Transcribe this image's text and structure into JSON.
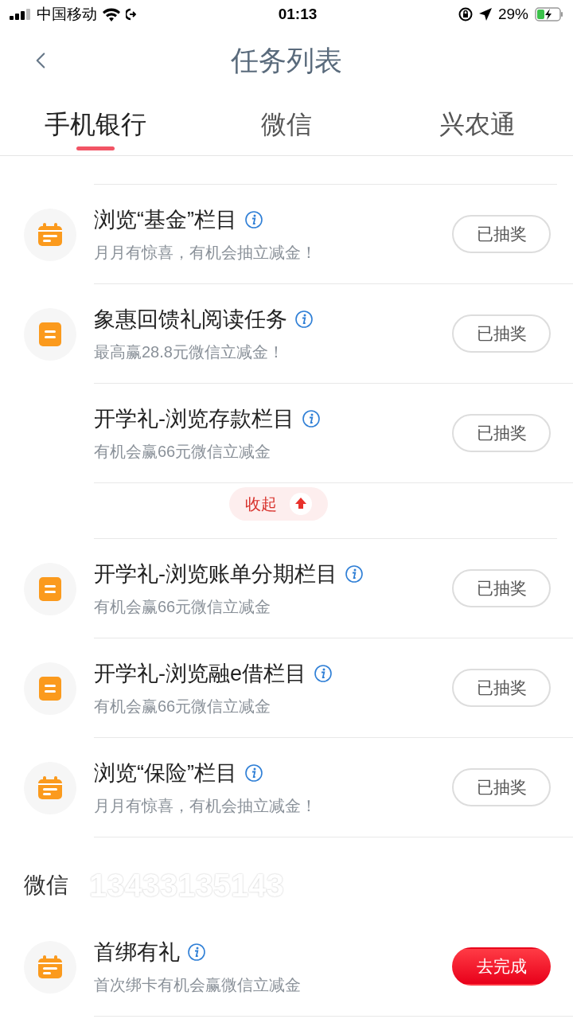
{
  "status_bar": {
    "carrier": "中国移动",
    "time": "01:13",
    "battery": "29%"
  },
  "header": {
    "title": "任务列表"
  },
  "tabs": [
    {
      "label": "手机银行",
      "selected": true
    },
    {
      "label": "微信",
      "selected": false
    },
    {
      "label": "兴农通",
      "selected": false
    }
  ],
  "sections": [
    {
      "tasks": [
        {
          "kind": "calendar",
          "title": "浏览“基金”栏目",
          "subtitle": "月月有惊喜，有机会抽立减金！",
          "button": {
            "label": "已抽奖",
            "kind": "done"
          }
        },
        {
          "kind": "document",
          "title": "象惠回馈礼阅读任务",
          "subtitle": "最高赢28.8元微信立减金！",
          "button": {
            "label": "已抽奖",
            "kind": "done"
          }
        },
        {
          "kind": "plain",
          "title": "开学礼-浏览存款栏目",
          "subtitle": "有机会赢66元微信立减金",
          "button": {
            "label": "已抽奖",
            "kind": "done"
          }
        },
        {
          "kind": "collapse",
          "label": "收起"
        },
        {
          "kind": "document",
          "title": "开学礼-浏览账单分期栏目",
          "subtitle": "有机会赢66元微信立减金",
          "button": {
            "label": "已抽奖",
            "kind": "done"
          }
        },
        {
          "kind": "document",
          "title": "开学礼-浏览融e借栏目",
          "subtitle": "有机会赢66元微信立减金",
          "button": {
            "label": "已抽奖",
            "kind": "done"
          }
        },
        {
          "kind": "calendar",
          "title": "浏览“保险”栏目",
          "subtitle": "月月有惊喜，有机会抽立减金！",
          "button": {
            "label": "已抽奖",
            "kind": "done"
          }
        }
      ]
    },
    {
      "heading": "微信",
      "watermark": "13433135143",
      "tasks": [
        {
          "kind": "calendar",
          "title": "首绑有礼",
          "subtitle": "首次绑卡有机会赢微信立减金",
          "button": {
            "label": "去完成",
            "kind": "todo"
          }
        }
      ]
    }
  ]
}
